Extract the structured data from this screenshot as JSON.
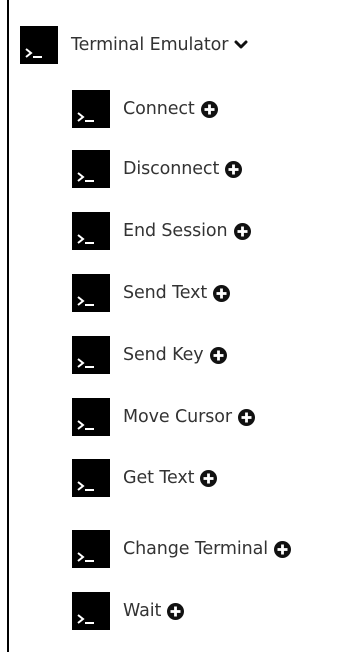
{
  "tree": {
    "header": {
      "label": "Terminal Emulator",
      "icon": "terminal-icon",
      "toggle_icon": "chevron-down-icon",
      "expanded": true
    },
    "items": [
      {
        "label": "Connect",
        "icon": "terminal-icon",
        "action_icon": "plus-circle-icon"
      },
      {
        "label": "Disconnect",
        "icon": "terminal-icon",
        "action_icon": "plus-circle-icon"
      },
      {
        "label": "End Session",
        "icon": "terminal-icon",
        "action_icon": "plus-circle-icon"
      },
      {
        "label": "Send Text",
        "icon": "terminal-icon",
        "action_icon": "plus-circle-icon"
      },
      {
        "label": "Send Key",
        "icon": "terminal-icon",
        "action_icon": "plus-circle-icon"
      },
      {
        "label": "Move Cursor",
        "icon": "terminal-icon",
        "action_icon": "plus-circle-icon"
      },
      {
        "label": "Get Text",
        "icon": "terminal-icon",
        "action_icon": "plus-circle-icon"
      },
      {
        "label": "Change Terminal",
        "icon": "terminal-icon",
        "action_icon": "plus-circle-icon"
      },
      {
        "label": "Wait",
        "icon": "terminal-icon",
        "action_icon": "plus-circle-icon"
      }
    ]
  },
  "colors": {
    "text": "#333333",
    "icon_background": "#000000",
    "icon_glyph": "#ffffff",
    "rule": "#000000"
  }
}
